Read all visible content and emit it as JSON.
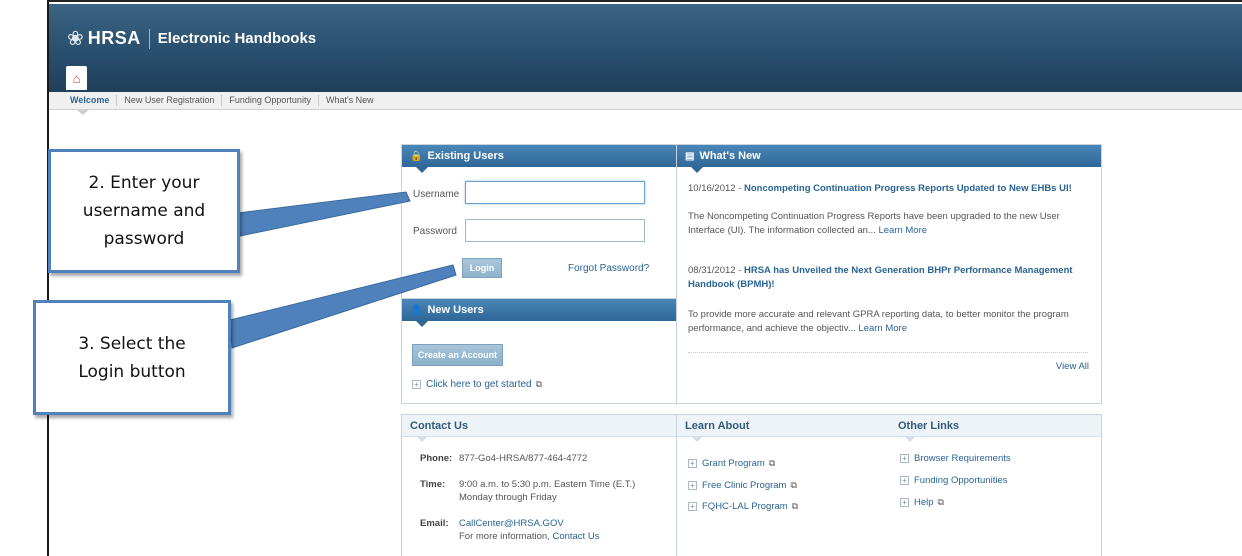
{
  "header": {
    "brand": "HRSA",
    "title": "Electronic Handbooks"
  },
  "nav": {
    "items": [
      "Welcome",
      "New User Registration",
      "Funding Opportunity",
      "What's New"
    ]
  },
  "existing_users": {
    "heading": "Existing Users",
    "username_label": "Username",
    "password_label": "Password",
    "login_label": "Login",
    "forgot_label": "Forgot Password?"
  },
  "new_users": {
    "heading": "New Users",
    "create_label": "Create an Account",
    "started_label": "Click here to get started"
  },
  "contact": {
    "heading": "Contact Us",
    "phone_label": "Phone:",
    "phone": "877-Go4-HRSA/877-464-4772",
    "time_label": "Time:",
    "time_line1": "9:00 a.m. to 5:30 p.m. Eastern Time (E.T.)",
    "time_line2": "Monday through Friday",
    "email_label": "Email:",
    "email": "CallCenter@HRSA.GOV",
    "more_prefix": "For more information,",
    "more_link": "Contact Us"
  },
  "whats_new": {
    "heading": "What's New",
    "items": [
      {
        "date": "10/16/2012 -",
        "title": "Noncompeting Continuation Progress Reports Updated to New EHBs UI!",
        "body": "The Noncompeting Continuation Progress Reports have been upgraded to the new User Interface (UI). The information collected an...",
        "more": "Learn More"
      },
      {
        "date": "08/31/2012 -",
        "title": "HRSA has Unveiled the Next Generation BHPr Performance Management Handbook (BPMH)!",
        "body": "To provide more accurate and relevant GPRA reporting data, to better monitor the program performance, and achieve the objectiv...",
        "more": "Learn More"
      }
    ],
    "view_all": "View All"
  },
  "learn_about": {
    "heading": "Learn About",
    "items": [
      "Grant Program",
      "Free Clinic Program",
      "FQHC-LAL Program"
    ]
  },
  "other_links": {
    "heading": "Other Links",
    "items": [
      "Browser Requirements",
      "Funding Opportunities",
      "Help"
    ]
  },
  "callouts": {
    "step2": [
      "2. Enter your",
      "username and",
      "password"
    ],
    "step3": [
      "3. Select the",
      "Login button"
    ]
  },
  "colors": {
    "banner": "#274d6c",
    "panel_header": "#3a77aa",
    "link": "#2a6495",
    "callout_border": "#4f81bd"
  }
}
